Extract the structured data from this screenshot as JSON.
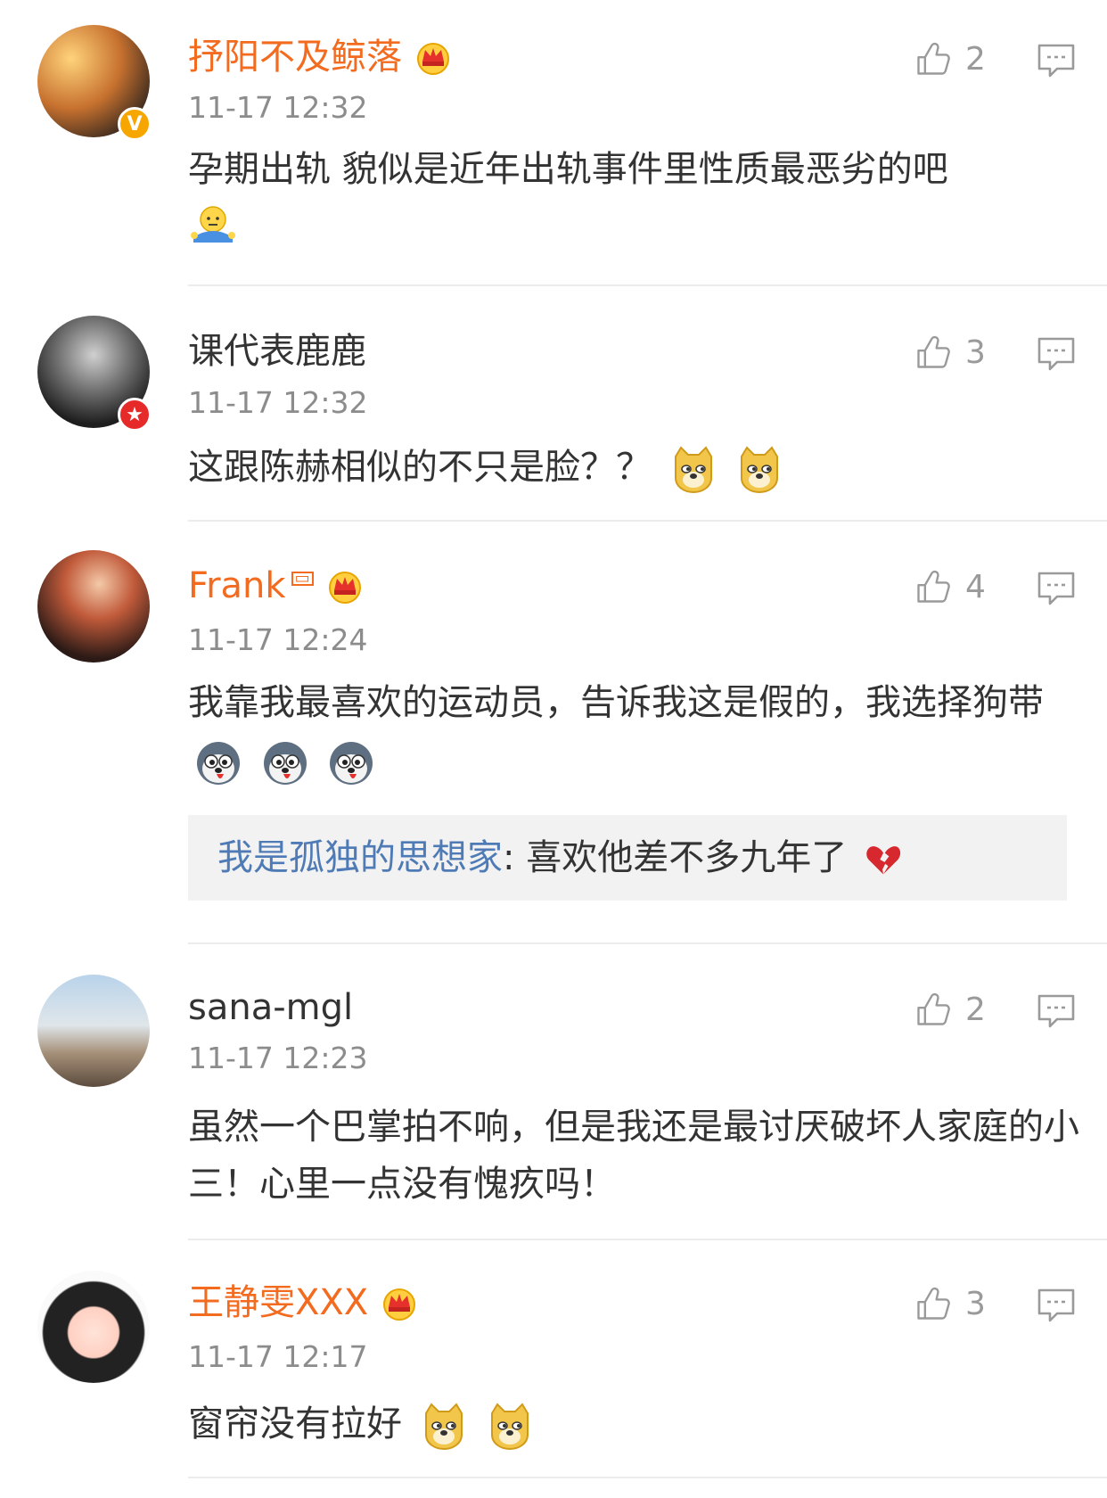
{
  "comments": [
    {
      "name": "抒阳不及鲸落",
      "time": "11-17 12:32",
      "likes": "2",
      "text": "孕期出轨 貌似是近年出轨事件里性质最恶劣的吧",
      "emoji": [
        "shrug-emoji"
      ],
      "badge": "verified-v-badge"
    },
    {
      "name": "课代表鹿鹿",
      "time": "11-17 12:32",
      "likes": "3",
      "text": "这跟陈赫相似的不只是脸？？",
      "emoji": [
        "doge-emoji",
        "doge-emoji"
      ],
      "badge": "star-badge"
    },
    {
      "name": "Frank",
      "time": "11-17 12:24",
      "likes": "4",
      "text": "我靠我最喜欢的运动员，告诉我这是假的，我选择狗带",
      "emoji": [
        "husky-emoji",
        "husky-emoji",
        "husky-emoji"
      ],
      "reply_user": "我是孤独的思想家",
      "reply_text": ": 喜欢他差不多九年了"
    },
    {
      "name": "sana-mgl",
      "time": "11-17 12:23",
      "likes": "2",
      "text": "虽然一个巴掌拍不响，但是我还是最讨厌破坏人家庭的小三！心里一点没有愧疚吗！"
    },
    {
      "name": "王静雯XXX",
      "time": "11-17 12:17",
      "likes": "3",
      "text": "窗帘没有拉好",
      "emoji": [
        "doge-emoji",
        "doge-emoji"
      ]
    }
  ],
  "colors": {
    "vip_name": "#f26b1f",
    "normal_name": "#333333",
    "time": "#8c8c8c",
    "reply_user": "#4e7bb5",
    "divider": "#ececec"
  }
}
